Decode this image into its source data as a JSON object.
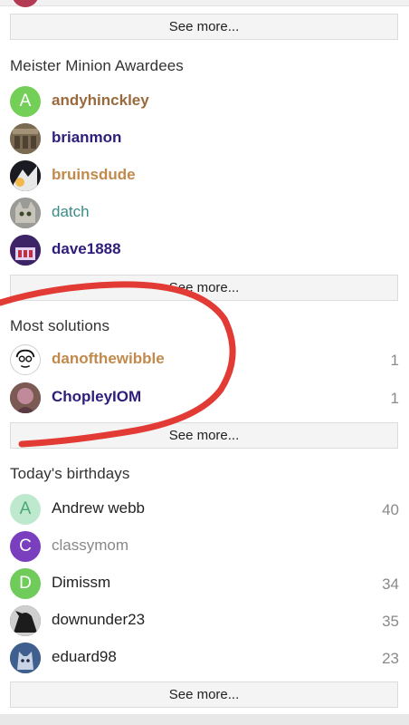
{
  "see_more_label": "See more...",
  "sections": {
    "awardees": {
      "title": "Meister Minion Awardees",
      "items": [
        {
          "name": "andyhinckley",
          "initial": "A"
        },
        {
          "name": "brianmon"
        },
        {
          "name": "bruinsdude"
        },
        {
          "name": "datch"
        },
        {
          "name": "dave1888"
        }
      ]
    },
    "solutions": {
      "title": "Most solutions",
      "items": [
        {
          "name": "danofthewibble",
          "count": "1"
        },
        {
          "name": "ChopleyIOM",
          "count": "1"
        }
      ]
    },
    "birthdays": {
      "title": "Today's birthdays",
      "items": [
        {
          "name": "Andrew webb",
          "initial": "A",
          "count": "40"
        },
        {
          "name": "classymom",
          "initial": "C"
        },
        {
          "name": "Dimissm",
          "initial": "D",
          "count": "34"
        },
        {
          "name": "downunder23",
          "count": "35"
        },
        {
          "name": "eduard98",
          "count": "23"
        }
      ]
    }
  },
  "colors": {
    "brown_name": "#9a6a3c",
    "navy_name": "#2e1d7a",
    "gold_name": "#c18a4c",
    "teal_name": "#3a8c86",
    "annotation_red": "#e23b35"
  }
}
